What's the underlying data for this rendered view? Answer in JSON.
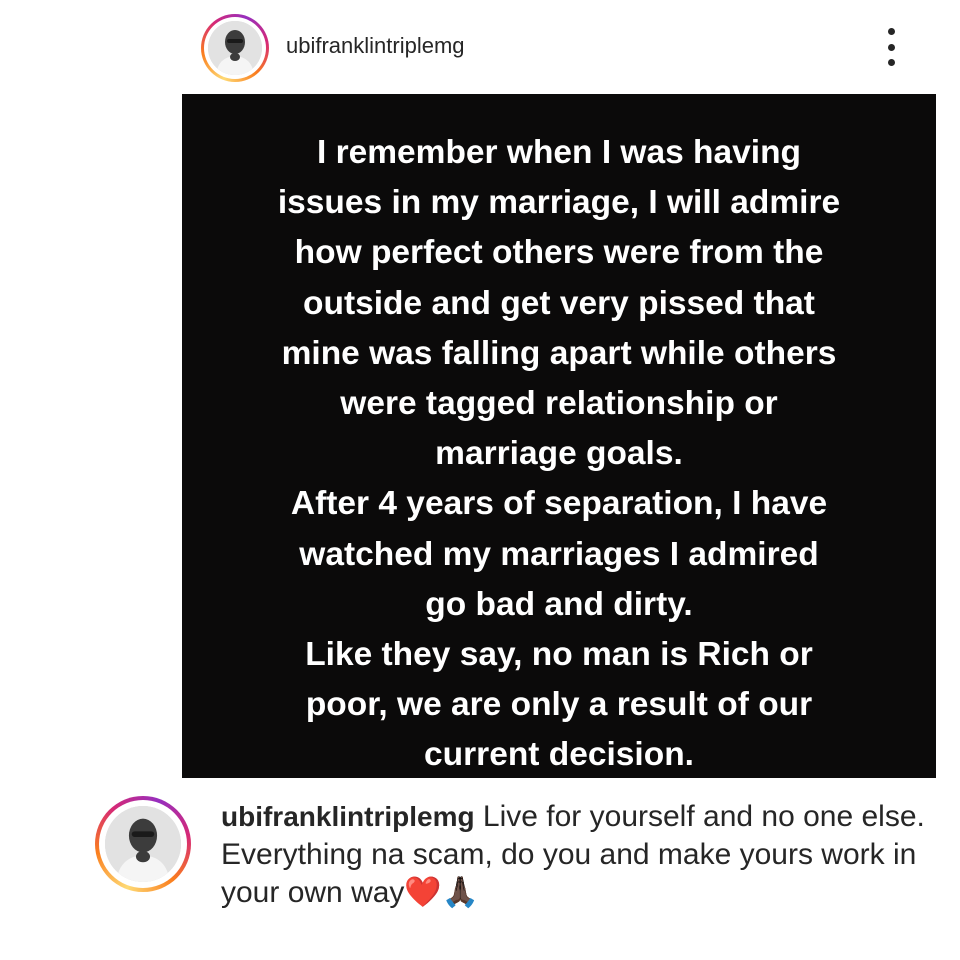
{
  "post": {
    "username": "ubifranklintriplemg",
    "story_lines": [
      "I remember when I was having",
      "issues in my marriage, I will admire",
      "how perfect others were from the",
      "outside and get very pissed that",
      "mine was falling apart while others",
      "were tagged relationship or",
      "marriage goals.",
      "After 4 years of separation, I have",
      "watched my marriages I admired",
      "go bad and dirty.",
      "Like they say, no man is Rich or",
      "poor, we are only a result of our",
      "current decision."
    ]
  },
  "caption": {
    "username": "ubifranklintriplemg",
    "text_1": "Live for yourself and no one else.",
    "text_2": "Everything na scam, do you and make yours work in your own way",
    "emoji": "❤️🙏🏿"
  },
  "icons": {
    "more": "more-vertical-icon"
  },
  "colors": {
    "story_background": "#0b0a0a",
    "text": "#262626",
    "ring_gradient": [
      "#feda75",
      "#fa7e1e",
      "#d62976",
      "#962fbf"
    ]
  }
}
